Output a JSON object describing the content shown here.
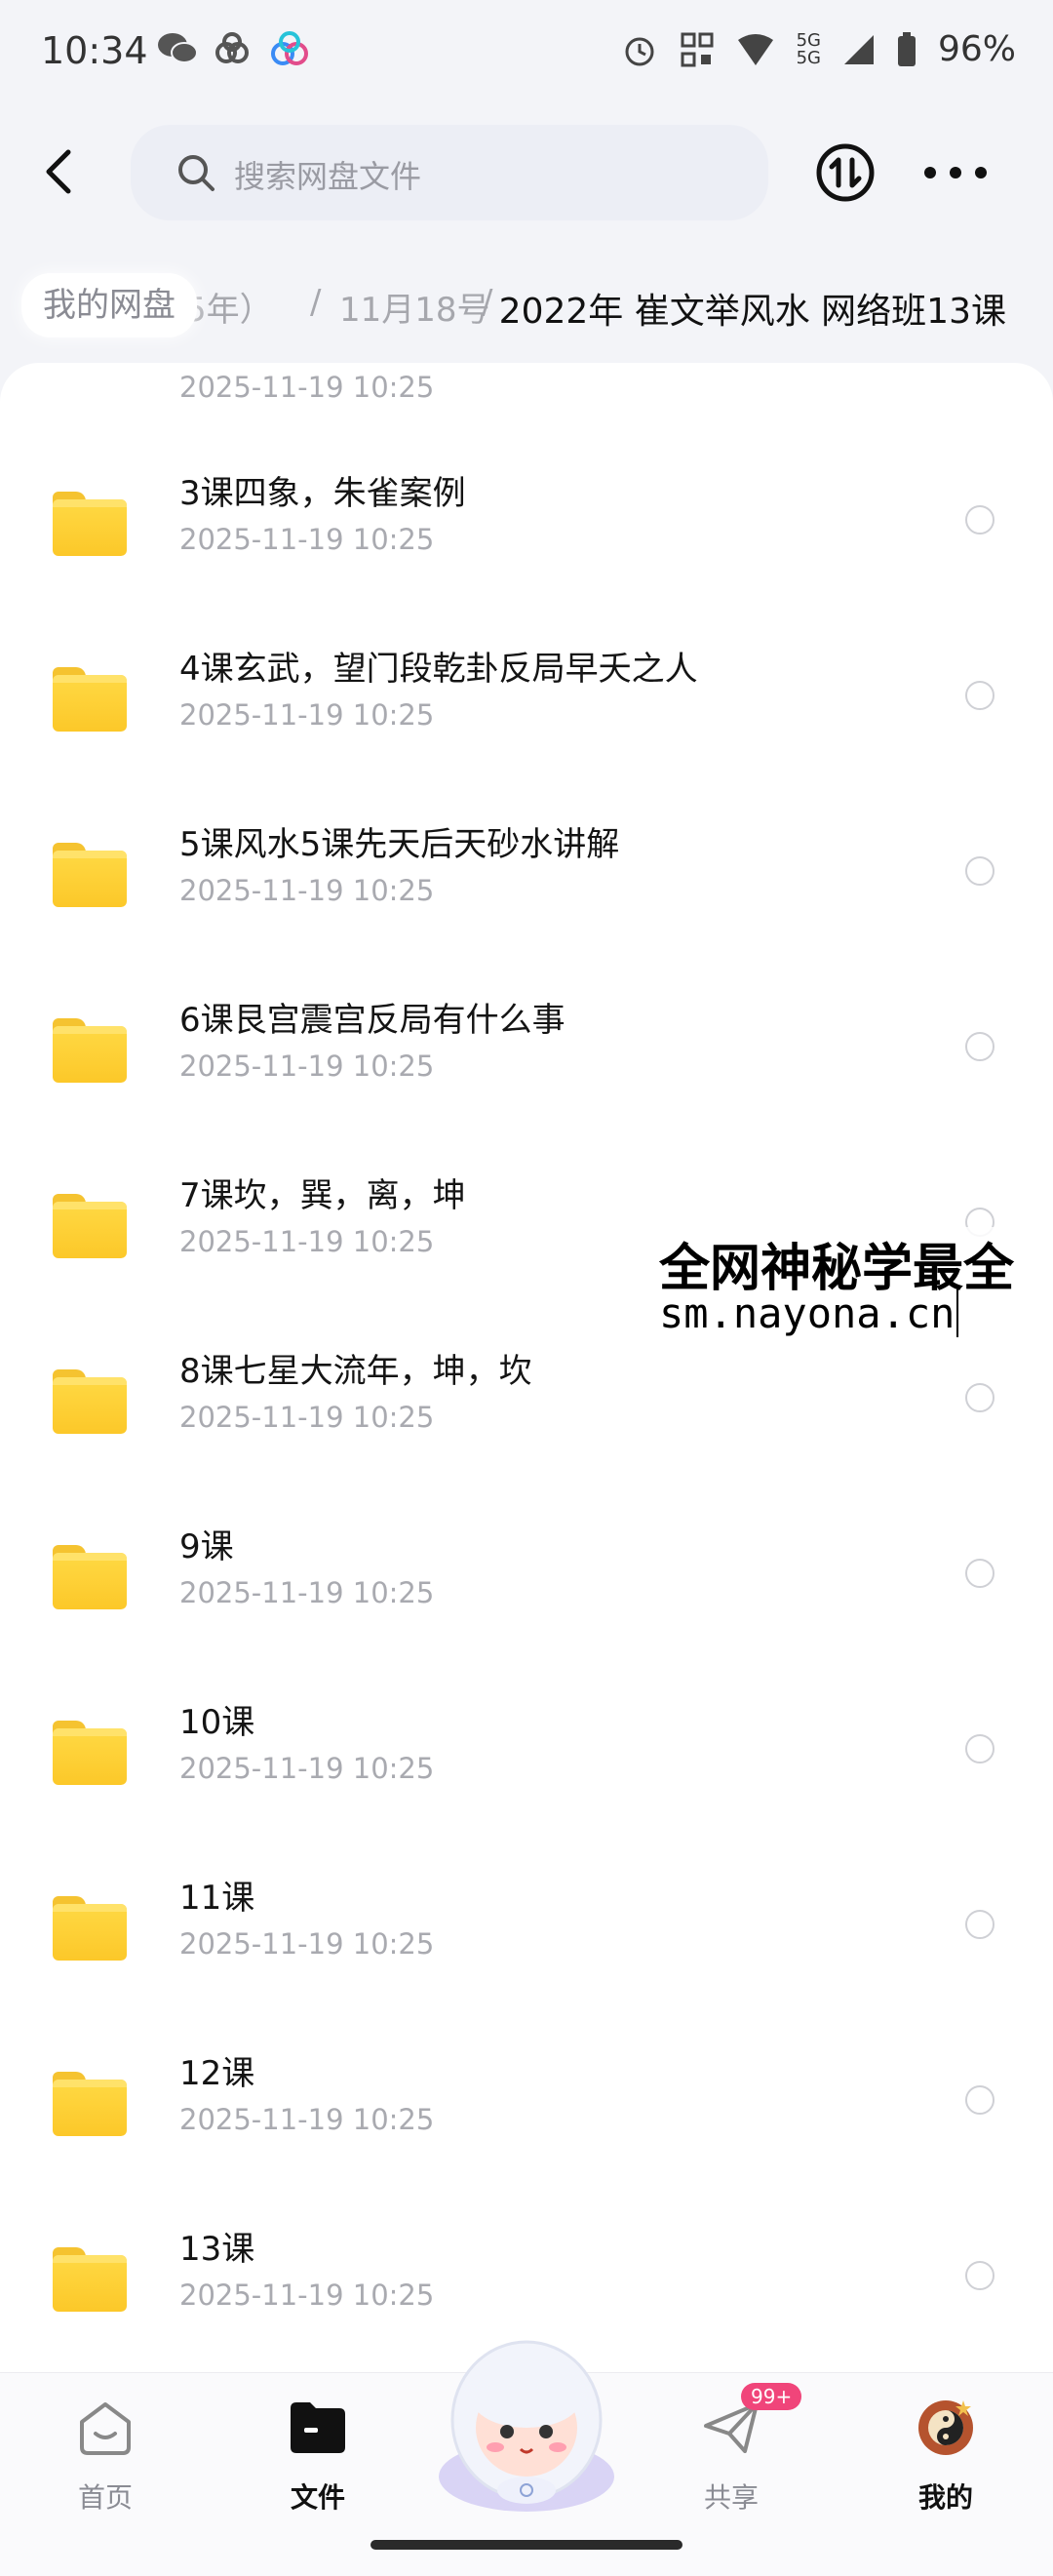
{
  "status_bar": {
    "time": "10:34",
    "network": "5G",
    "network2": "5G",
    "battery": "96%"
  },
  "header": {
    "search_placeholder": "搜索网盘文件"
  },
  "breadcrumb": {
    "root": "我的网盘",
    "partial": "5年）",
    "level": "11月18号",
    "current": "2022年 崔文举风水 网络班13课",
    "separator": "/"
  },
  "files": [
    {
      "name": "",
      "date": "2025-11-19  10:25"
    },
    {
      "name": "3课四象，朱雀案例",
      "date": "2025-11-19  10:25"
    },
    {
      "name": "4课玄武，望门段乾卦反局早夭之人",
      "date": "2025-11-19  10:25"
    },
    {
      "name": "5课风水5课先天后天砂水讲解",
      "date": "2025-11-19  10:25"
    },
    {
      "name": "6课艮宫震宫反局有什么事",
      "date": "2025-11-19  10:25"
    },
    {
      "name": "7课坎，巽，离，坤",
      "date": "2025-11-19  10:25"
    },
    {
      "name": "8课七星大流年，坤，坎",
      "date": "2025-11-19  10:25"
    },
    {
      "name": "9课",
      "date": "2025-11-19  10:25"
    },
    {
      "name": "10课",
      "date": "2025-11-19  10:25"
    },
    {
      "name": "11课",
      "date": "2025-11-19  10:25"
    },
    {
      "name": "12课",
      "date": "2025-11-19  10:25"
    },
    {
      "name": "13课",
      "date": "2025-11-19  10:25"
    }
  ],
  "watermark": {
    "line1": "全网神秘学最全",
    "line2": "sm.nayona.cn"
  },
  "bottom_nav": {
    "home": "首页",
    "files": "文件",
    "share": "共享",
    "share_badge": "99+",
    "mine": "我的"
  },
  "colors": {
    "folder": "#fcc829",
    "badge": "#f0457a",
    "accent_text": "#111111"
  }
}
